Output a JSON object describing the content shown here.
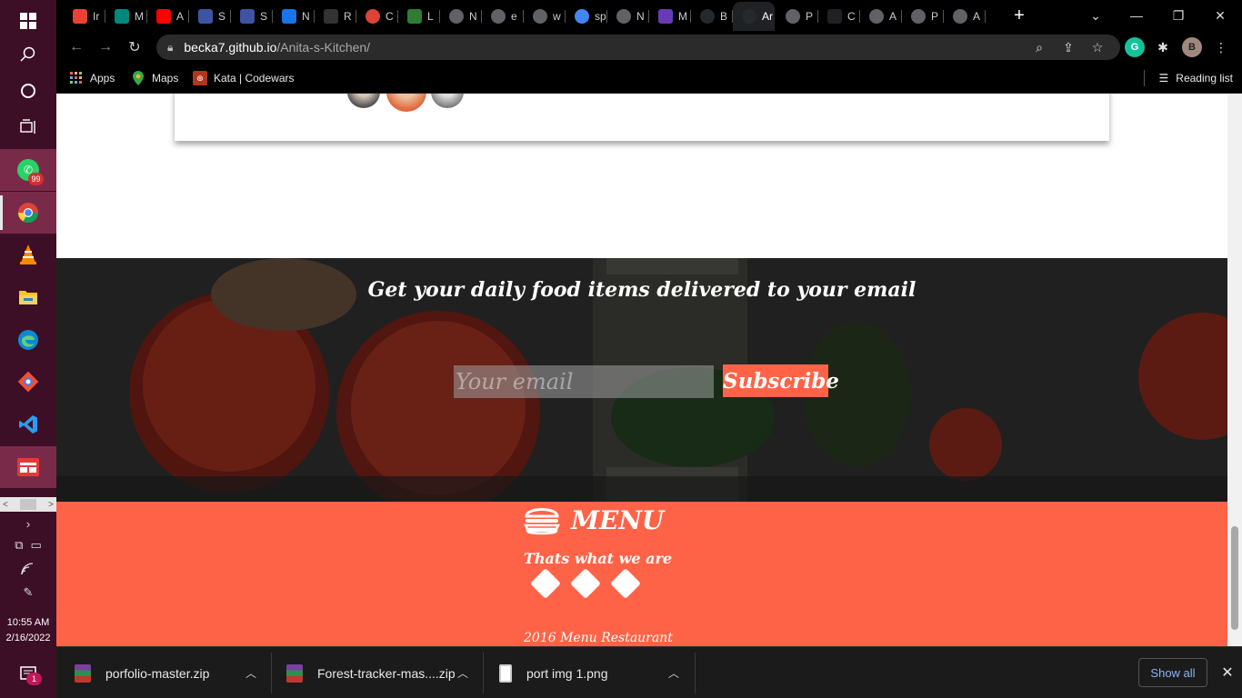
{
  "taskbar": {
    "whatsapp_badge": "99",
    "time": "10:55 AM",
    "date": "2/16/2022",
    "notification_count": "1"
  },
  "browser": {
    "tabs": [
      {
        "label": "Ir",
        "icon": "gmail-icon",
        "color": "#ea4335"
      },
      {
        "label": "M",
        "icon": "meet-icon",
        "color": "#00897b"
      },
      {
        "label": "A",
        "icon": "youtube-icon",
        "color": "#ff0000"
      },
      {
        "label": "S",
        "icon": "frontend-mentor-icon",
        "color": "#3e54a3"
      },
      {
        "label": "S",
        "icon": "frontend-mentor-icon",
        "color": "#3e54a3"
      },
      {
        "label": "N",
        "icon": "bookmark-icon",
        "color": "#1a73e8"
      },
      {
        "label": "R",
        "icon": "codewars-icon",
        "color": "#333333"
      },
      {
        "label": "C",
        "icon": "chrome-icon",
        "color": "#db4437"
      },
      {
        "label": "L",
        "icon": "w-icon",
        "color": "#2e7d32"
      },
      {
        "label": "N",
        "icon": "globe-icon",
        "color": "#5f6368"
      },
      {
        "label": "e",
        "icon": "globe-icon",
        "color": "#5f6368"
      },
      {
        "label": "w",
        "icon": "globe-icon",
        "color": "#5f6368"
      },
      {
        "label": "sp",
        "icon": "google-icon",
        "color": "#4285f4"
      },
      {
        "label": "N",
        "icon": "globe-icon",
        "color": "#5f6368"
      },
      {
        "label": "M",
        "icon": "b-icon",
        "color": "#673ab7"
      },
      {
        "label": "B",
        "icon": "github-icon",
        "color": "#24292e"
      }
    ],
    "active_tab": {
      "label": "Ar",
      "icon": "github-icon"
    },
    "after_tabs": [
      {
        "label": "P",
        "icon": "globe-icon"
      },
      {
        "label": "C",
        "icon": "a-icon"
      },
      {
        "label": "A",
        "icon": "globe-icon"
      },
      {
        "label": "P",
        "icon": "globe-icon"
      },
      {
        "label": "A",
        "icon": "globe-icon"
      }
    ],
    "url_host": "becka7.github.io",
    "url_path": "/Anita-s-Kitchen/",
    "profile_initial": "B",
    "grammarly_initial": "G",
    "bookmarks": [
      {
        "label": "Apps",
        "icon": "apps-grid-icon"
      },
      {
        "label": "Maps",
        "icon": "maps-pin-icon"
      },
      {
        "label": "Kata | Codewars",
        "icon": "codewars-icon"
      }
    ],
    "reading_list": "Reading list"
  },
  "page": {
    "newsletter_title": "Get your daily food items delivered to your email",
    "email_placeholder": "Your email",
    "subscribe_label": "Subscribe",
    "brand_name": "MENU",
    "tagline": "Thats what we are",
    "copyright": "2016 Menu Restaurant",
    "accent_color": "#ff6347"
  },
  "downloads": {
    "items": [
      {
        "name": "porfolio-master.zip",
        "icon": "winrar-archive-icon"
      },
      {
        "name": "Forest-tracker-mas....zip",
        "icon": "winrar-archive-icon"
      },
      {
        "name": "port img 1.png",
        "icon": "image-file-icon"
      }
    ],
    "show_all": "Show all"
  }
}
